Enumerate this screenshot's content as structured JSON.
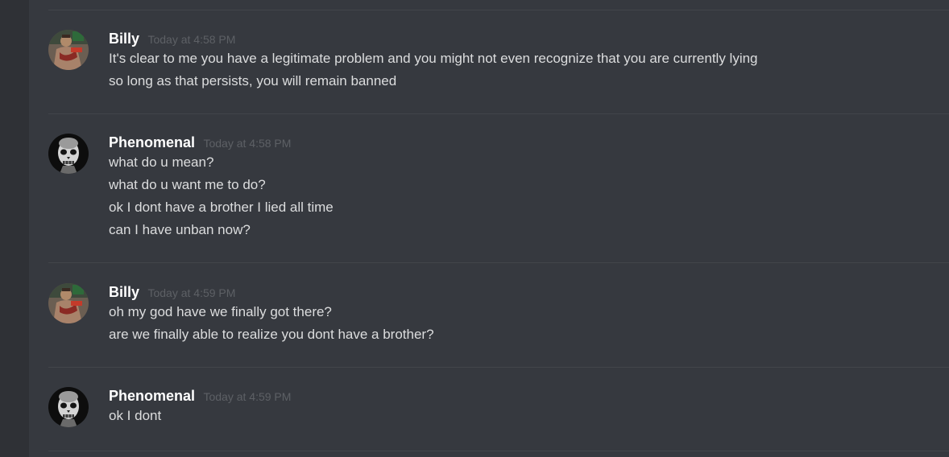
{
  "messages": [
    {
      "username": "Billy",
      "avatar_icon": "billy-avatar-icon",
      "timestamp": "Today at 4:58 PM",
      "lines": [
        "It's clear to me you have a legitimate problem and you might not even recognize that you are currently lying",
        "so long as that persists, you will remain banned"
      ]
    },
    {
      "username": "Phenomenal",
      "avatar_icon": "skull-avatar-icon",
      "timestamp": "Today at 4:58 PM",
      "lines": [
        "what do u mean?",
        "what do u want me to do?",
        "ok I dont have a brother I lied all time",
        "can I have unban now?"
      ]
    },
    {
      "username": "Billy",
      "avatar_icon": "billy-avatar-icon",
      "timestamp": "Today at 4:59 PM",
      "lines": [
        "oh my god have we finally got there?",
        "are we finally able to realize you dont have a brother?"
      ]
    },
    {
      "username": "Phenomenal",
      "avatar_icon": "skull-avatar-icon",
      "timestamp": "Today at 4:59 PM",
      "lines": [
        "ok I dont"
      ]
    }
  ],
  "colors": {
    "background": "#36393f",
    "left_rail": "#2f3136",
    "divider": "#42454a",
    "username": "#ffffff",
    "timestamp": "#5d6065",
    "message_text": "#dcddde"
  }
}
